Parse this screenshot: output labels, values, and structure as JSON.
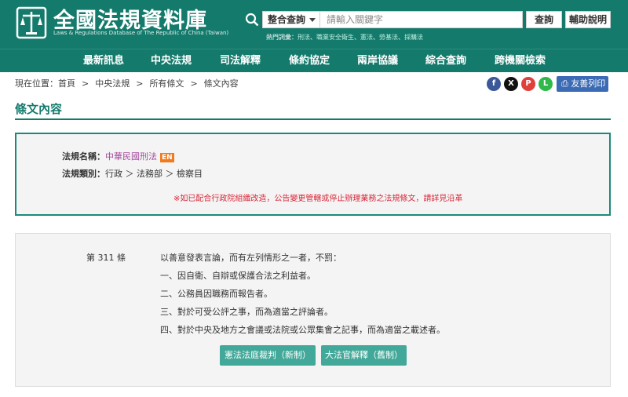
{
  "header": {
    "site_title": "全國法規資料庫",
    "site_subtitle": "Laws & Regulations Database of The Republic of China (Taiwan)"
  },
  "search": {
    "scope_label": "整合查詢",
    "placeholder": "請輸入關鍵字",
    "submit_label": "查詢",
    "help_label": "輔助說明",
    "hot_label": "熱門詞彙：",
    "hot_terms": [
      "刑法",
      "職業安全衛生",
      "憲法",
      "勞基法",
      "採購法"
    ]
  },
  "nav": {
    "items": [
      "最新訊息",
      "中央法規",
      "司法解釋",
      "條約協定",
      "兩岸協議",
      "綜合查詢",
      "跨機關檢索"
    ]
  },
  "breadcrumb": {
    "prefix": "現在位置：",
    "items": [
      "首頁",
      "中央法規",
      "所有條文",
      "條文內容"
    ]
  },
  "share": {
    "facebook": "f",
    "x": "X",
    "plurk": "P",
    "line": "L",
    "print_label": "友善列印"
  },
  "section": {
    "title": "條文內容"
  },
  "law_info": {
    "name_label": "法規名稱：",
    "name_value": "中華民國刑法",
    "en_badge": "EN",
    "category_label": "法規類別：",
    "category_value": "行政 ＞ 法務部 ＞ 檢察目",
    "notice": "※如已配合行政院組織改造，公告變更管轄或停止辦理業務之法規條文，請詳見沿革"
  },
  "article": {
    "number": "第 311 條",
    "lines": [
      "以善意發表言論，而有左列情形之一者，不罰：",
      "一、因自衛、自辯或保護合法之利益者。",
      "二、公務員因職務而報告者。",
      "三、對於可受公評之事，而為適當之評論者。",
      "四、對於中央及地方之會議或法院或公眾集會之記事，而為適當之載述者。"
    ],
    "buttons": [
      "憲法法庭裁判（新制）",
      "大法官解釋（舊制）"
    ]
  },
  "colors": {
    "brand": "#147a6c",
    "notice_red": "#d9283a",
    "link_purple": "#a2489b",
    "badge_orange": "#f07a1e"
  }
}
